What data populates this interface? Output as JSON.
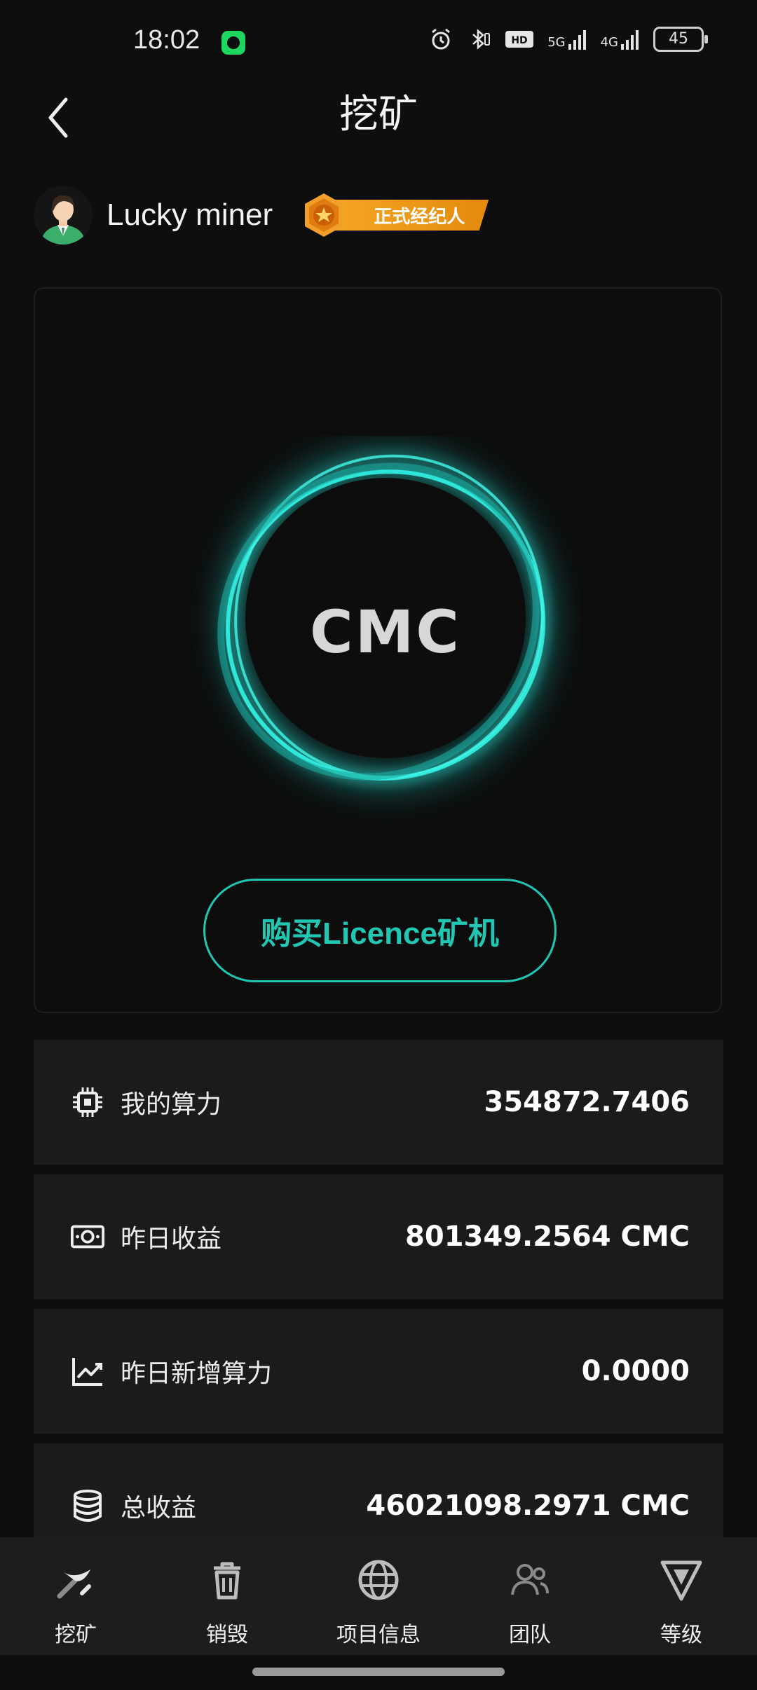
{
  "status_bar": {
    "time": "18:02",
    "battery": "45",
    "network_5g": "5G",
    "network_4g": "4G"
  },
  "header": {
    "title": "挖矿",
    "back_icon": "chevron-left-icon"
  },
  "profile": {
    "username": "Lucky miner",
    "badge_label": "正式经纪人"
  },
  "mining": {
    "orb_label": "CMC",
    "buy_button_label": "购买Licence矿机"
  },
  "stats": [
    {
      "icon": "cpu-chip-icon",
      "label": "我的算力",
      "value": "354872.7406"
    },
    {
      "icon": "money-bill-icon",
      "label": "昨日收益",
      "value": "801349.2564 CMC"
    },
    {
      "icon": "line-chart-icon",
      "label": "昨日新增算力",
      "value": "0.0000"
    },
    {
      "icon": "database-icon",
      "label": "总收益",
      "value": "46021098.2971 CMC"
    }
  ],
  "nav": [
    {
      "icon": "pickaxe-icon",
      "label": "挖矿"
    },
    {
      "icon": "trash-icon",
      "label": "销毁"
    },
    {
      "icon": "globe-icon",
      "label": "项目信息"
    },
    {
      "icon": "team-icon",
      "label": "团队"
    },
    {
      "icon": "level-icon",
      "label": "等级"
    }
  ],
  "colors": {
    "accent": "#21c7b3",
    "background": "#0e0e0e",
    "row_background": "#1b1b1b",
    "badge": "#f5a623"
  }
}
